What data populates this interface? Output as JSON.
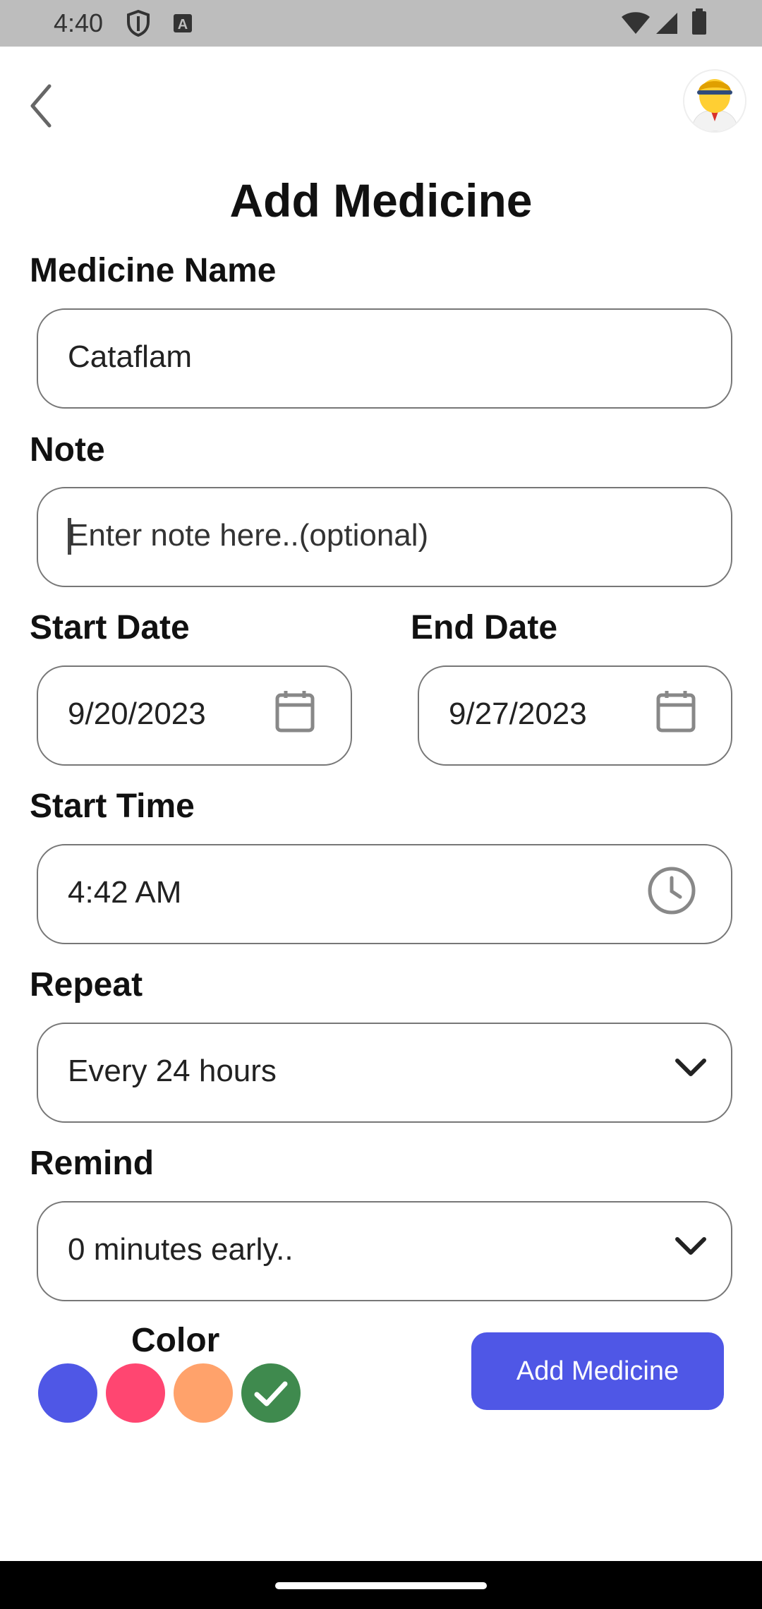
{
  "status_bar": {
    "time": "4:40",
    "icons": [
      "shield-icon",
      "keyboard-a-icon",
      "wifi-icon",
      "signal-icon",
      "battery-icon"
    ]
  },
  "header": {
    "back_icon": "chevron-left-icon",
    "avatar_icon": "user-avatar"
  },
  "page": {
    "title": "Add Medicine"
  },
  "form": {
    "medicine_name": {
      "label": "Medicine Name",
      "value": "Cataflam"
    },
    "note": {
      "label": "Note",
      "placeholder": "Enter note here..(optional)"
    },
    "start_date": {
      "label": "Start Date",
      "value": "9/20/2023",
      "icon": "calendar-icon"
    },
    "end_date": {
      "label": "End Date",
      "value": "9/27/2023",
      "icon": "calendar-icon"
    },
    "start_time": {
      "label": "Start Time",
      "value": "4:42 AM",
      "icon": "clock-icon"
    },
    "repeat": {
      "label": "Repeat",
      "value": "Every 24 hours",
      "icon": "chevron-down-icon"
    },
    "remind": {
      "label": "Remind",
      "value": "0 minutes early..",
      "icon": "chevron-down-icon"
    }
  },
  "color": {
    "label": "Color",
    "options": [
      {
        "name": "blue",
        "hex": "#4f57e6",
        "selected": false
      },
      {
        "name": "pink",
        "hex": "#ff4671",
        "selected": false
      },
      {
        "name": "orange",
        "hex": "#ffa26b",
        "selected": false
      },
      {
        "name": "green",
        "hex": "#3f8a4e",
        "selected": true
      }
    ]
  },
  "actions": {
    "add_label": "Add Medicine",
    "add_color": "#4f57e6"
  }
}
